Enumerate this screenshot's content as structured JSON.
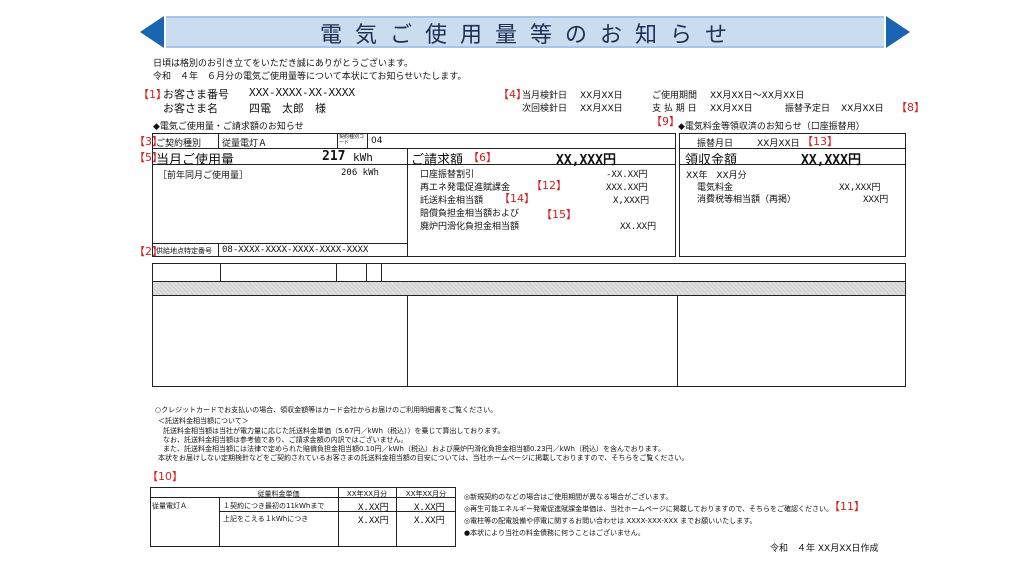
{
  "header": {
    "title": "電 気 ご 使 用 量 等 の お 知 ら せ",
    "intro1": "日頃は格別のお引き立てをいただき誠にありがとうございます。",
    "intro2": "令和　４年　６月分の電気ご使用量等について本状にてお知らせいたします。",
    "colors": {
      "banner": "#c9dcf0",
      "arrow": "#1a64b4",
      "marker": "#d42020"
    }
  },
  "customer": {
    "m1": "【1】",
    "number_label": "お客さま番号",
    "number_value": "XXX-XXXX-XX-XXXX",
    "name_label": "お客さま名",
    "name_value": "四電　太郎　様"
  },
  "meter": {
    "m4": "【4】",
    "current_label": "当月検針日",
    "current_value": "XX月XX日",
    "next_label": "次回検針日",
    "next_value": "XX月XX日",
    "period_label": "ご使用期間",
    "period_value": "XX月XX日～XX月XX日",
    "payment_label": "支 払 期 日",
    "payment_value": "XX月XX日",
    "transfer_label": "振替予定日",
    "transfer_value": "XX月XX日",
    "m8": "【8】"
  },
  "section_left": "◆電気ご使用量・ご請求額のお知らせ",
  "section_right": {
    "m9": "【9】",
    "text": "◆電気料金等領収済のお知らせ（口座振替用）"
  },
  "contract": {
    "m3": "【3】",
    "type_label": "ご契約種別",
    "type_value": "従量電灯Ａ",
    "class_label": "契約種別コード",
    "class_value": "04"
  },
  "usage": {
    "m5": "【5】",
    "label": "当月ご使用量",
    "value": "217",
    "unit": "kWh",
    "prev_label": "［前年同月ご使用量］",
    "prev_value": "206 kWh"
  },
  "billing": {
    "label": "ご請求額",
    "m6": "【6】",
    "value": "XX,XXX円",
    "rows": [
      {
        "label": "口座振替割引",
        "value": "-XX.XX円",
        "m": ""
      },
      {
        "label": "再エネ発電促進賦課金",
        "value": "XXX.XX円",
        "m": "【12】"
      },
      {
        "label": "託送料金相当額",
        "value": "X,XXX円",
        "m": "【14】"
      }
    ],
    "comp_label1": "賠償負担金相当額および",
    "m15": "【15】",
    "comp_label2": "廃炉円滑化負担金相当額",
    "comp_value": "XX.XX円"
  },
  "supply_point": {
    "m2": "【2】",
    "label": "供給地点特定番号",
    "value": "08-XXXX-XXXX-XXXX-XXXX-XXXX"
  },
  "receipt": {
    "transfer_label": "振替月日",
    "transfer_value": "XX月XX日",
    "m13": "【13】",
    "amount_label": "領収金額",
    "amount_value": "XX,XXX円",
    "month_label": "XX年　XX月分",
    "fee_label": "電気料金",
    "fee_value": "XX,XXX円",
    "tax_label": "消費税等相当額（再掲）",
    "tax_value": "XXX円"
  },
  "notes": {
    "credit": "○クレジットカードでお支払いの場合、領収金額等はカード会社からお届けのご利用明細書をご覧ください。",
    "head": "＜託送料金相当額について＞",
    "l1": "託送料金相当額は当社が電力量に応じた託送料金単価（5.67円／kWh（税込））を乗じて算出しております。",
    "l2": "なお、託送料金相当額は参考値であり、ご請求金額の内訳ではございません。",
    "l3": "また、託送料金相当額には法律で定められた賠償負担金相当額0.10円／kWh（税込）および廃炉円滑化負担金相当額0.23円／kWh（税込）を含んでおります。",
    "l4": "本状をお届けしない定期検針などをご契約されているお客さまの託送料金相当額の目安については、当社ホームページに掲載しておりますので、そちらをご覧ください。"
  },
  "rate_table": {
    "m10": "【10】",
    "header": "従量料金単価",
    "col1": "XX年XX月分",
    "col2": "XX年XX月分",
    "plan": "従量電灯Ａ",
    "rows": [
      {
        "label": "１契約につき最初の11kWhまで",
        "v1": "X.XX円",
        "v2": "X.XX円"
      },
      {
        "label": "上記をこえる１kWhにつき",
        "v1": "X.XX円",
        "v2": "X.XX円"
      }
    ]
  },
  "notes_right": {
    "r1": "◎新規契約のなどの場合はご使用期間が異なる場合がございます。",
    "r2": "◎再生可能エネルギー発電促進賦課金単価は、当社ホームページに掲載しておりますので、そちらをご確認ください。",
    "m11": "【11】",
    "r3": "◎電柱等の配電設備や停電に関するお問い合わせは XXXX-XXX-XXX までお願いいたします。",
    "r4": "●本状により当社の料金債務に何うことはございません。"
  },
  "footer": {
    "date": "令和　４年 XX月XX日作成"
  }
}
